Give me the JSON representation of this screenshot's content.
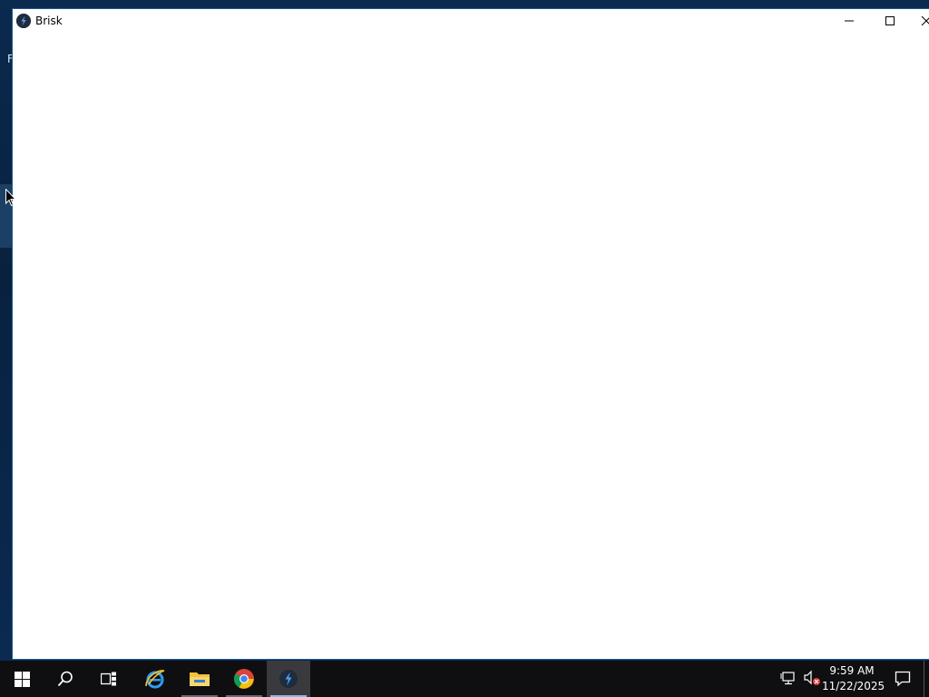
{
  "desktop": {
    "edge_text": "F"
  },
  "window": {
    "title": "Brisk",
    "icon": "brisk-app-icon",
    "controls": [
      "minimize",
      "maximize",
      "close"
    ]
  },
  "taskbar": {
    "pinned": [
      {
        "name": "start",
        "icon": "windows-logo-icon"
      },
      {
        "name": "search",
        "icon": "search-icon"
      },
      {
        "name": "task-view",
        "icon": "task-view-icon"
      },
      {
        "name": "internet-explorer",
        "icon": "ie-icon"
      },
      {
        "name": "file-explorer",
        "icon": "folder-icon"
      },
      {
        "name": "chrome",
        "icon": "chrome-icon"
      },
      {
        "name": "brisk",
        "icon": "brisk-icon",
        "active": true
      }
    ],
    "tray": {
      "network_icon": "network-icon",
      "volume_icon": "volume-muted-icon",
      "time": "9:59 AM",
      "date": "11/22/2025"
    }
  },
  "colors": {
    "desktop_bg": "#0a2a4e",
    "taskbar_bg": "#0f0f12",
    "active_accent": "#8fb8e6"
  }
}
